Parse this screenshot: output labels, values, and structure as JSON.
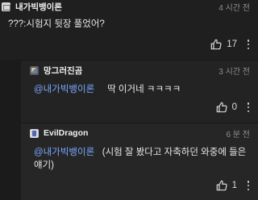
{
  "comments": [
    {
      "author": "내가빅뱅이론",
      "time": "4 시간 전",
      "text": "???:시험지 뒷장 풀었어?",
      "likes": "17",
      "avatar_icon": "photo-avatar-icon"
    },
    {
      "author": "망그러진곰",
      "time": "3 시간 전",
      "mention": "@내가빅뱅이론",
      "text": "딱 이거네 ㅋㅋㅋㅋ",
      "likes": "0",
      "avatar_icon": "bear-avatar-icon"
    },
    {
      "author": "EvilDragon",
      "time": "6 분 전",
      "mention": "@내가빅뱅이론",
      "text": "(시험 잘 봤다고 자축하던 와중에 들은 얘기)",
      "likes": "1",
      "avatar_icon": "character-avatar-icon"
    }
  ],
  "icons": {
    "like": "thumbs-up-icon",
    "menu": "more-vertical-icon"
  },
  "colors": {
    "background": "#1b1b1b",
    "mention": "#7aa7ff",
    "timestamp": "#8e8e8e"
  }
}
